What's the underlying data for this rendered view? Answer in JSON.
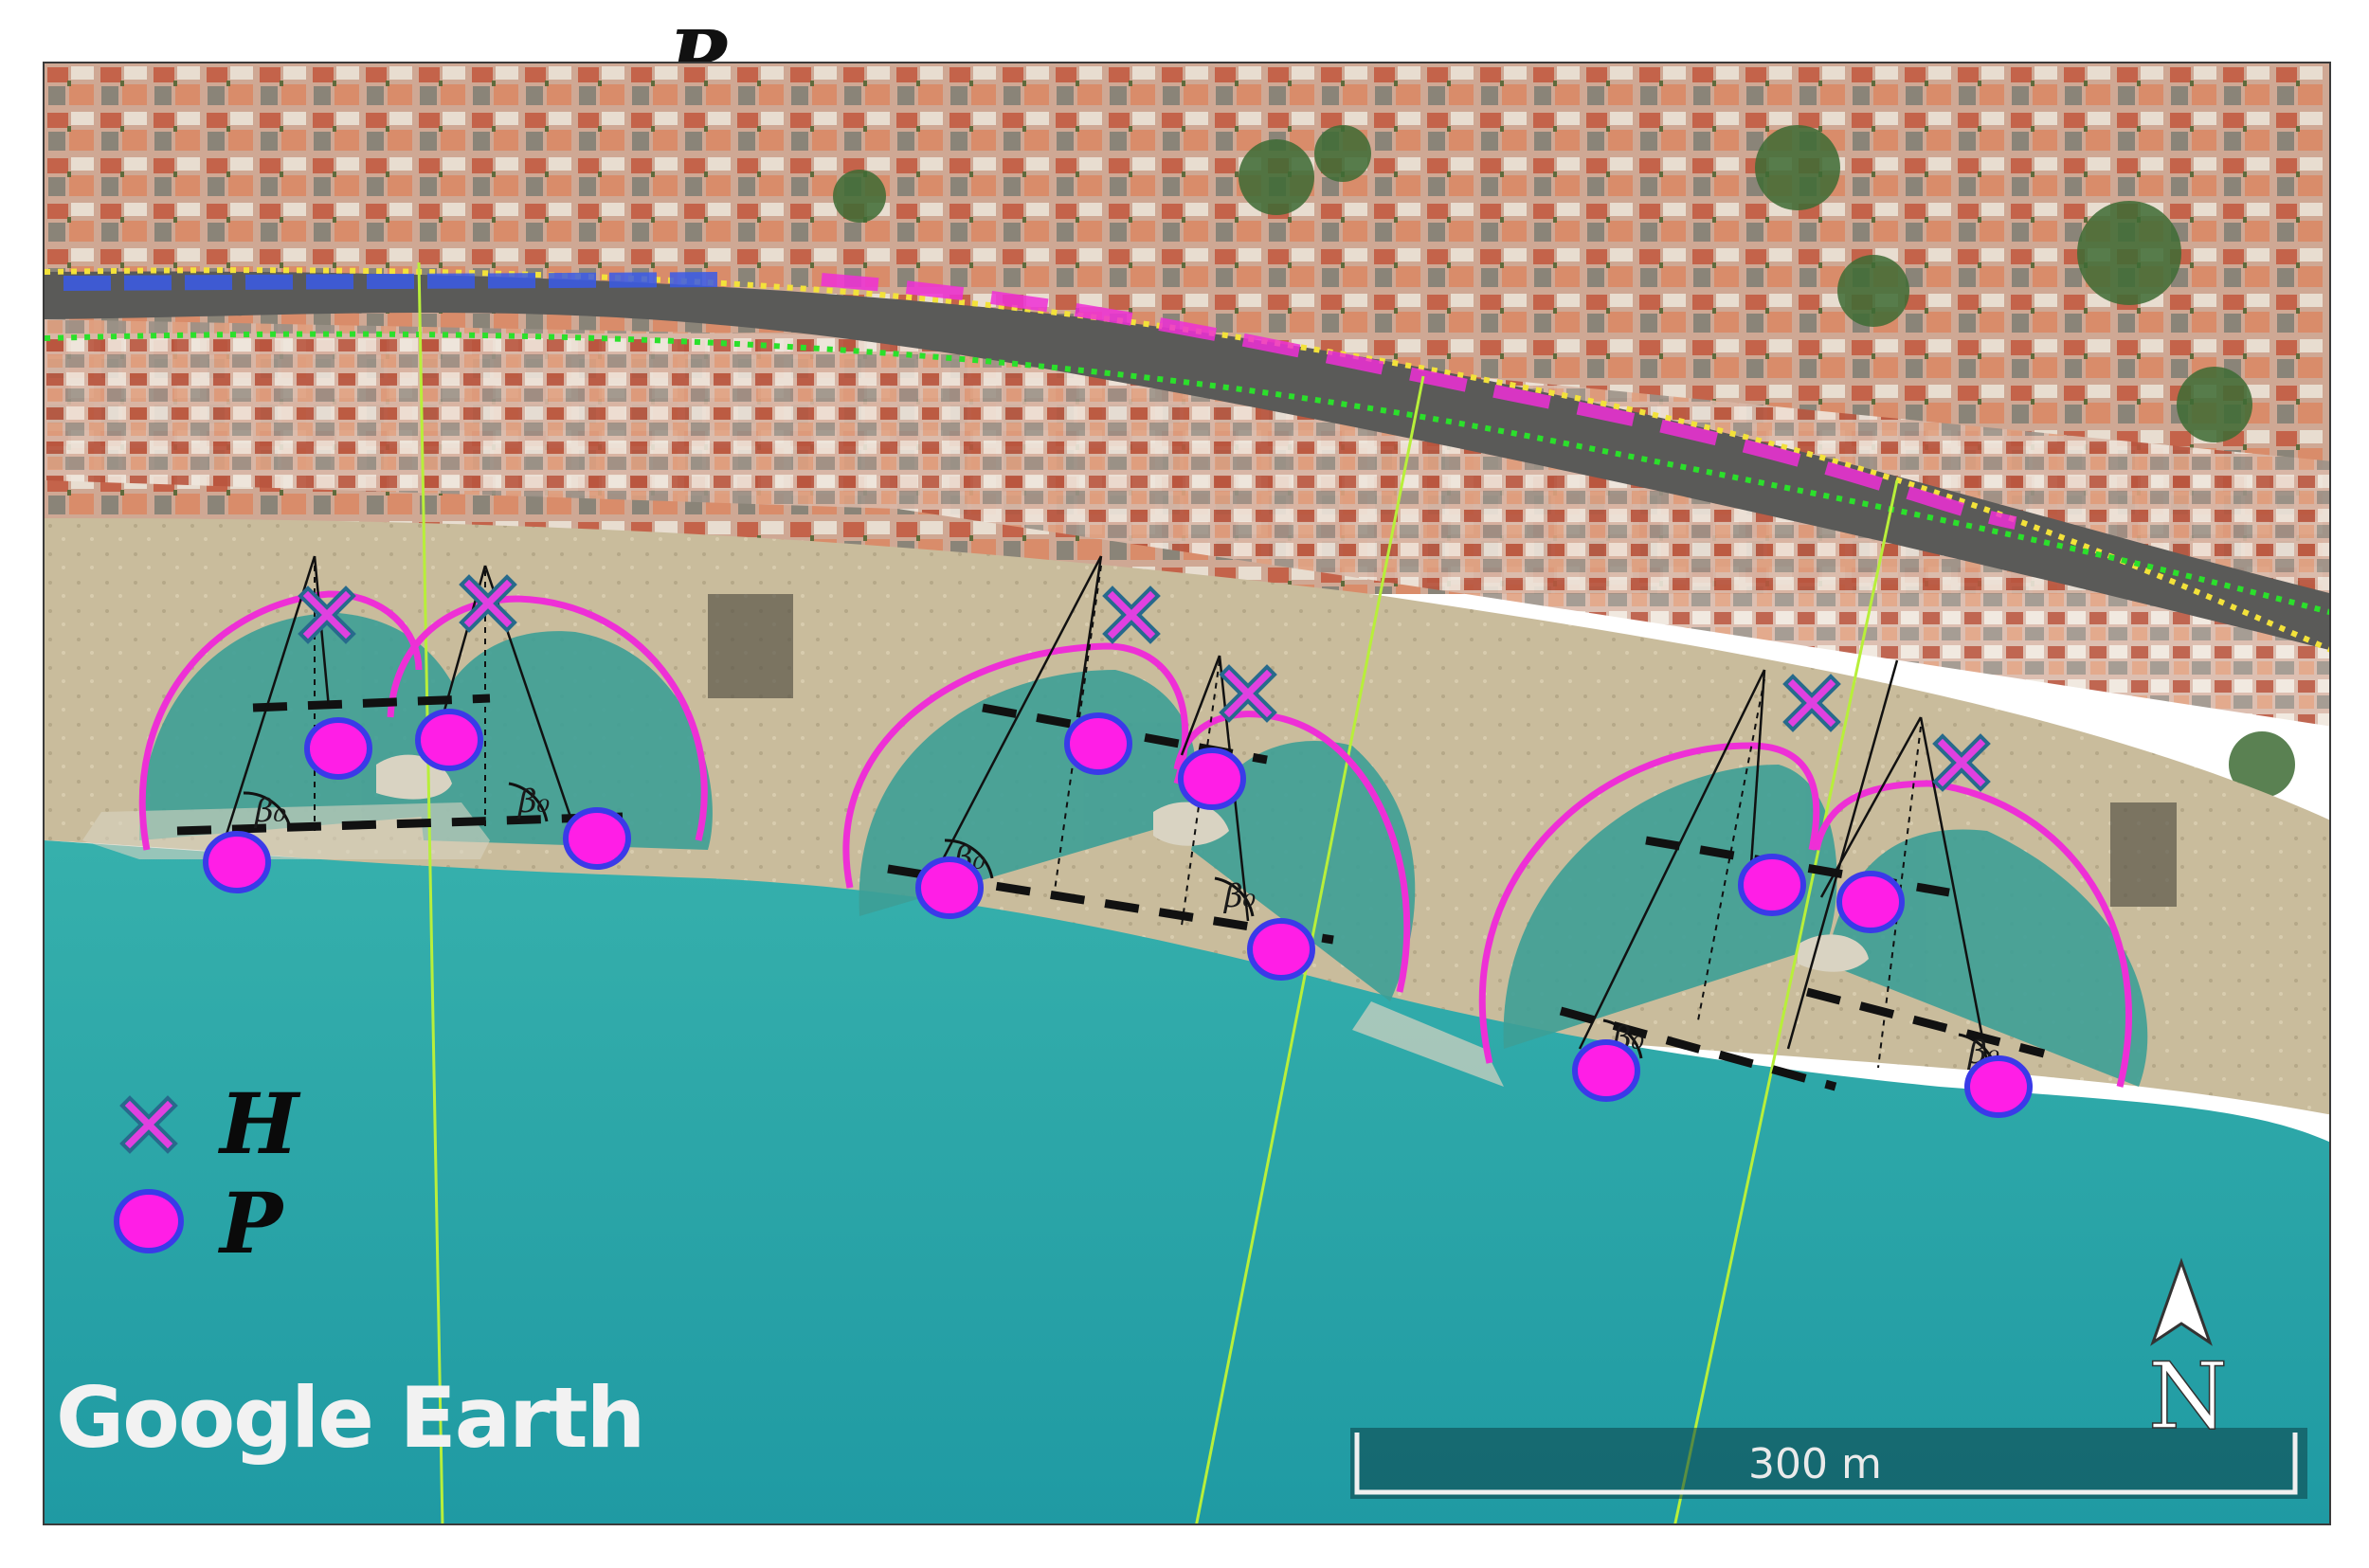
{
  "top_label": "P",
  "legend": {
    "headland": {
      "symbol": "x-marker-icon",
      "label": "H",
      "color": "#e040e0"
    },
    "point": {
      "symbol": "circle-marker-icon",
      "label": "P",
      "color": "#ff1ee6",
      "outline": "#3a3ae8"
    }
  },
  "angle_label": "β₀",
  "watermark": "Google Earth",
  "scale_bar": {
    "label": "300 m"
  },
  "north_arrow": {
    "label": "N"
  },
  "colors": {
    "sea": "#2aa3a6",
    "beach": "#c8b894",
    "bay_arc": "#ee2fd6",
    "reference_line": "#b8ef3a",
    "tangent_line": "#111111",
    "road_overlay_yellow": "#f3e23a",
    "road_overlay_green": "#2be02b"
  }
}
